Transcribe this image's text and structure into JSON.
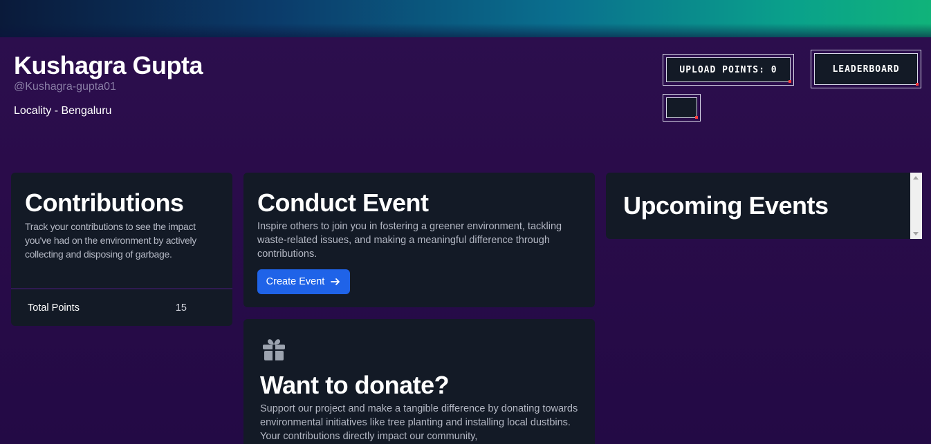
{
  "profile": {
    "name": "Kushagra Gupta",
    "handle": "@Kushagra-gupta01",
    "locality": "Locality - Bengaluru"
  },
  "actions": {
    "upload_points": "UPLOAD POINTS: 0",
    "leaderboard": "LEADERBOARD",
    "small_button": ""
  },
  "contributions": {
    "title": "Contributions",
    "description": "Track your contributions to see the impact you've had on the environment by actively collecting and disposing of garbage.",
    "total_label": "Total Points",
    "total_value": "15"
  },
  "conduct_event": {
    "title": "Conduct Event",
    "description": "Inspire others to join you in fostering a greener environment, tackling waste-related issues, and making a meaningful difference through contributions.",
    "button_label": "Create Event"
  },
  "donate": {
    "title": "Want to donate?",
    "description": "Support our project and make a tangible difference by donating towards environmental initiatives like tree planting and installing local dustbins. Your contributions directly impact our community,"
  },
  "upcoming": {
    "title": "Upcoming Events"
  },
  "icons": {
    "arrow": "arrow-right-icon",
    "gift": "gift-icon"
  },
  "colors": {
    "accent": "#1f63e8",
    "card_bg": "#131a26",
    "page_bg": "#2a0c4a"
  }
}
